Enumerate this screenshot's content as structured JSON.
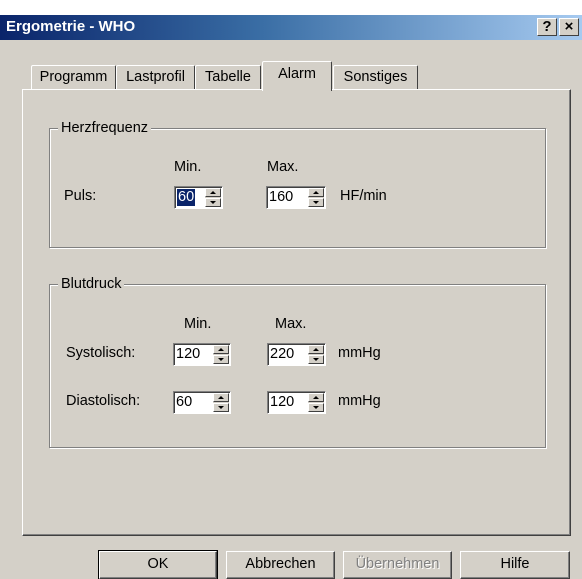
{
  "window": {
    "title": "Ergometrie - WHO",
    "help_glyph": "?",
    "close_glyph": "×",
    "colors": {
      "titlebar_start": "#0a246a",
      "titlebar_end": "#a6caf0",
      "face": "#d4d0c8"
    }
  },
  "tabs": [
    {
      "label": "Programm",
      "active": false
    },
    {
      "label": "Lastprofil",
      "active": false
    },
    {
      "label": "Tabelle",
      "active": false
    },
    {
      "label": "Alarm",
      "active": true
    },
    {
      "label": "Sonstiges",
      "active": false
    }
  ],
  "herzfrequenz": {
    "legend": "Herzfrequenz",
    "min_header": "Min.",
    "max_header": "Max.",
    "row_label": "Puls:",
    "min_value": "60",
    "max_value": "160",
    "unit": "HF/min"
  },
  "blutdruck": {
    "legend": "Blutdruck",
    "min_header": "Min.",
    "max_header": "Max.",
    "systolisch": {
      "label": "Systolisch:",
      "min_value": "120",
      "max_value": "220",
      "unit": "mmHg"
    },
    "diastolisch": {
      "label": "Diastolisch:",
      "min_value": "60",
      "max_value": "120",
      "unit": "mmHg"
    }
  },
  "buttons": {
    "ok": "OK",
    "cancel": "Abbrechen",
    "apply": "Übernehmen",
    "help": "Hilfe"
  }
}
